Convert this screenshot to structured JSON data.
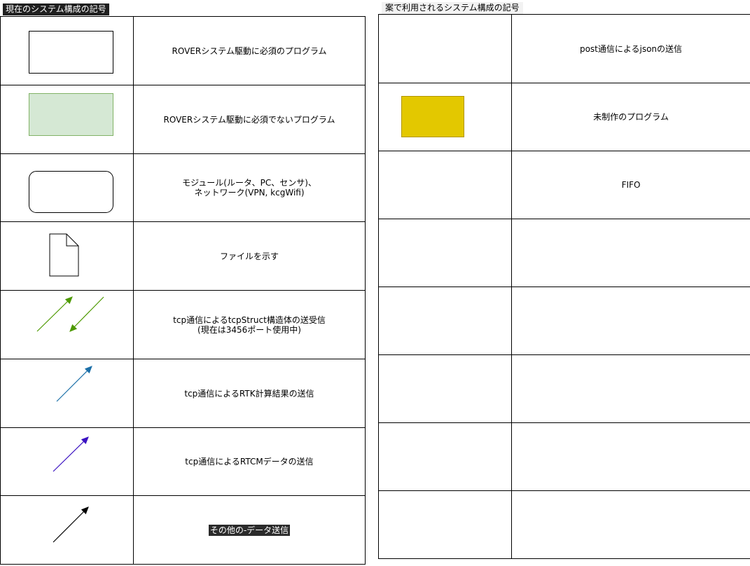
{
  "left_title": "現在のシステム構成の記号",
  "right_title": "案で利用されるシステム構成の記号",
  "left_rows": [
    {
      "symbol": "white-rectangle",
      "lines": [
        "ROVERシステム駆動に必須のプログラム"
      ]
    },
    {
      "symbol": "green-rectangle",
      "lines": [
        "ROVERシステム駆動に必須でないプログラム"
      ]
    },
    {
      "symbol": "rounded-rectangle",
      "lines": [
        "モジュール(ルータ、PC、センサ)、",
        "ネットワーク(VPN, kcgWifi)"
      ]
    },
    {
      "symbol": "file-icon",
      "lines": [
        "ファイルを示す"
      ]
    },
    {
      "symbol": "green-arrows-both",
      "lines": [
        "tcp通信によるtcpStruct構造体の送受信",
        "(現在は3456ポート使用中)"
      ]
    },
    {
      "symbol": "blue-arrow",
      "lines": [
        "tcp通信によるRTK計算結果の送信"
      ]
    },
    {
      "symbol": "purple-arrow",
      "lines": [
        "tcp通信によるRTCMデータの送信"
      ]
    },
    {
      "symbol": "black-arrow",
      "lines": [
        "その他の-データ送信"
      ]
    }
  ],
  "right_rows": [
    {
      "symbol": "red-double-arrow",
      "lines": [
        "post通信によるjsonの送信"
      ]
    },
    {
      "symbol": "yellow-rectangle",
      "lines": [
        "未制作のプログラム"
      ]
    },
    {
      "symbol": "gold-arrow",
      "lines": [
        "FIFO"
      ]
    },
    {
      "symbol": "empty",
      "lines": []
    },
    {
      "symbol": "empty",
      "lines": []
    },
    {
      "symbol": "empty",
      "lines": []
    },
    {
      "symbol": "empty",
      "lines": []
    },
    {
      "symbol": "empty",
      "lines": []
    }
  ],
  "colors": {
    "green_fill": "#d5e8d4",
    "green_stroke": "#82b366",
    "green_arrow": "#4d9900",
    "blue_arrow": "#1b6fa8",
    "purple_arrow": "#3b12c2",
    "black_arrow": "#000000",
    "red_arrow": "#b20000",
    "yellow_fill": "#e3c800",
    "gold_arrow": "#c49a00"
  }
}
